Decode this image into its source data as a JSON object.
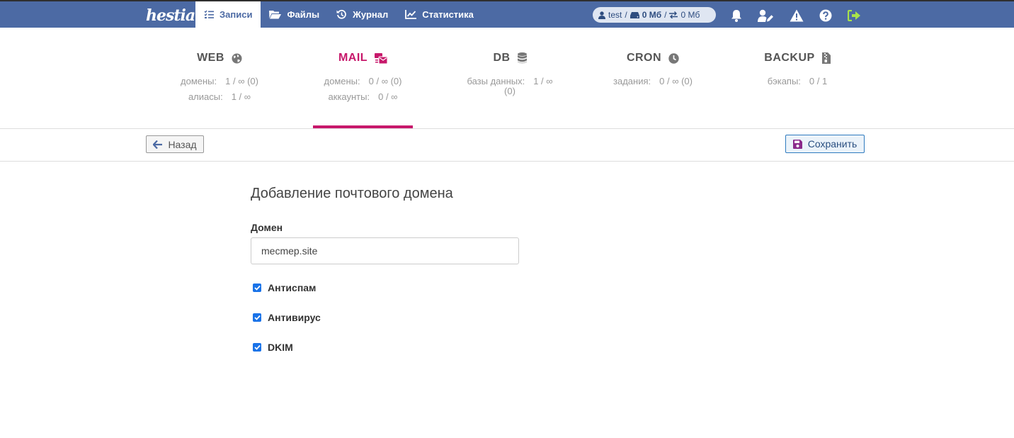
{
  "app": {
    "logo_text": "hestia"
  },
  "nav": [
    {
      "label": "Записи",
      "icon": "list-check-icon",
      "active": true
    },
    {
      "label": "Файлы",
      "icon": "folder-icon",
      "active": false
    },
    {
      "label": "Журнал",
      "icon": "history-icon",
      "active": false
    },
    {
      "label": "Статистика",
      "icon": "chart-line-icon",
      "active": false
    }
  ],
  "usage": {
    "user": "test",
    "disk": "0 Мб",
    "bandwidth": "0 Мб"
  },
  "stats": [
    {
      "title": "WEB",
      "icon": "globe-icon",
      "rows": [
        {
          "label": "домены:",
          "value": "1 / ∞ (0)"
        },
        {
          "label": "алиасы:",
          "value": "1 / ∞"
        }
      ]
    },
    {
      "title": "MAIL",
      "icon": "mail-bulk-icon",
      "active": true,
      "rows": [
        {
          "label": "домены:",
          "value": "0 / ∞ (0)"
        },
        {
          "label": "аккаунты:",
          "value": "0 / ∞"
        }
      ]
    },
    {
      "title": "DB",
      "icon": "database-icon",
      "rows": [
        {
          "label": "базы данных:",
          "value": "1 / ∞",
          "value2": "(0)"
        }
      ]
    },
    {
      "title": "CRON",
      "icon": "clock-icon",
      "rows": [
        {
          "label": "задания:",
          "value": "0 / ∞ (0)"
        }
      ]
    },
    {
      "title": "BACKUP",
      "icon": "file-archive-icon",
      "rows": [
        {
          "label": "бэкапы:",
          "value": "0 / 1"
        }
      ]
    }
  ],
  "toolbar": {
    "back_label": "Назад",
    "save_label": "Сохранить"
  },
  "form": {
    "title": "Добавление почтового домена",
    "domain_label": "Домен",
    "domain_value": "mecmep.site",
    "checkboxes": [
      {
        "label": "Антиспам",
        "checked": true
      },
      {
        "label": "Антивирус",
        "checked": true
      },
      {
        "label": "DKIM",
        "checked": true
      }
    ]
  },
  "colors": {
    "topbar": "#4c6aa4",
    "accent": "#c7186b",
    "checkbox": "#1a73e8",
    "logout": "#a8e34a"
  }
}
